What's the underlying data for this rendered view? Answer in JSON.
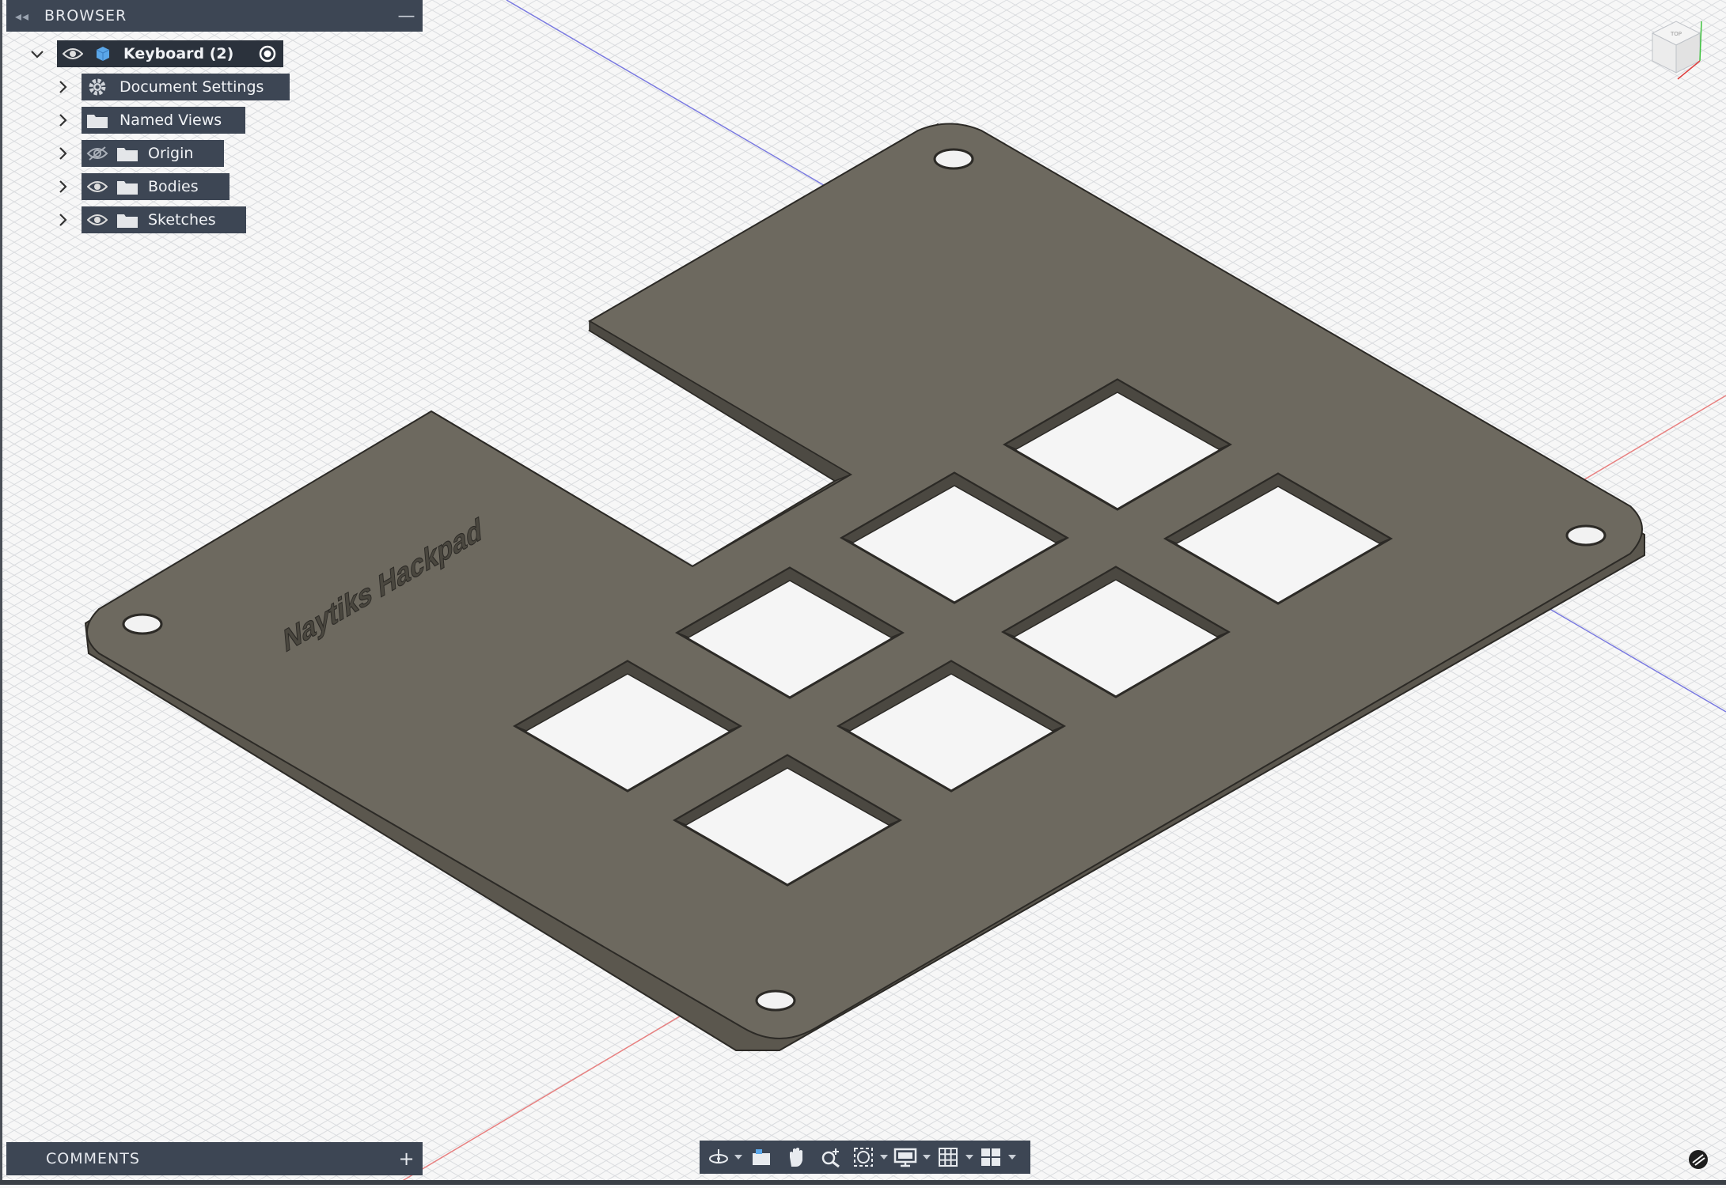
{
  "browser": {
    "title": "BROWSER",
    "root": {
      "label": "Keyboard (2)"
    },
    "items": [
      {
        "label": "Document Settings",
        "icon": "gear-icon"
      },
      {
        "label": "Named Views",
        "icon": "folder-icon"
      },
      {
        "label": "Origin",
        "icon": "folder-icon",
        "visibility": "hidden"
      },
      {
        "label": "Bodies",
        "icon": "folder-icon",
        "visibility": "visible"
      },
      {
        "label": "Sketches",
        "icon": "folder-icon",
        "visibility": "visible"
      }
    ]
  },
  "model": {
    "engraved_text": "Naytiks Hackpad",
    "body_color": "#6d695f"
  },
  "comments": {
    "title": "COMMENTS"
  },
  "toolbar": {
    "buttons": [
      "orbit-icon",
      "look-at-icon",
      "pan-icon",
      "zoom-icon",
      "fit-icon",
      "display-settings-icon",
      "grid-icon",
      "viewports-icon"
    ]
  },
  "colors": {
    "panel": "#3d4654",
    "grid": "#d4d6d9",
    "axis_x": "#e05555",
    "axis_z": "#5b5bdc"
  }
}
